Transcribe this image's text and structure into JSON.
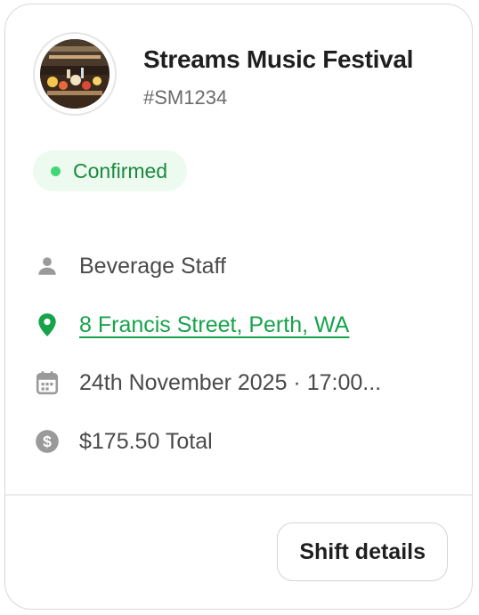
{
  "event": {
    "title": "Streams Music Festival",
    "reference": "#SM1234",
    "status": "Confirmed",
    "status_color": "#1b8a3e",
    "avatar_icon": "event-photo"
  },
  "details": [
    {
      "icon": "person-icon",
      "text": "Beverage Staff",
      "link": false
    },
    {
      "icon": "location-pin-icon",
      "text": "8 Francis Street, Perth, WA",
      "link": true
    },
    {
      "icon": "calendar-icon",
      "text": "24th November 2025 · 17:00...",
      "link": false
    },
    {
      "icon": "dollar-icon",
      "text": "$175.50 Total",
      "link": false
    }
  ],
  "actions": {
    "shift_details_label": "Shift details"
  },
  "colors": {
    "accent_green": "#17a34a",
    "badge_bg": "#ecfaf0",
    "icon_gray": "#9a9a9a"
  }
}
